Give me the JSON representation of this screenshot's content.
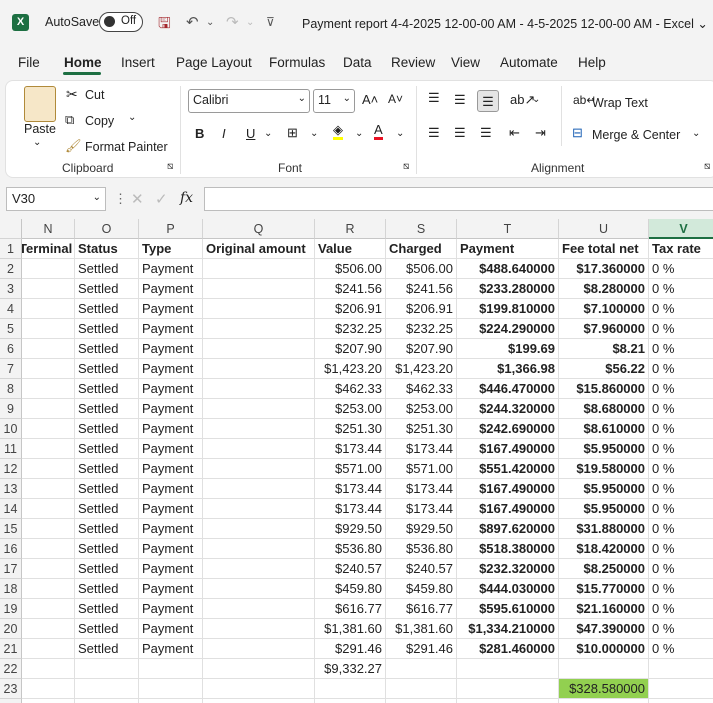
{
  "titlebar": {
    "logo": "X",
    "autosave_label": "AutoSave",
    "autosave_state": "Off",
    "title": "Payment report 4-4-2025 12-00-00 AM - 4-5-2025 12-00-00 AM  -  Excel ⌄"
  },
  "menu": [
    "File",
    "Home",
    "Insert",
    "Page Layout",
    "Formulas",
    "Data",
    "Review",
    "View",
    "Automate",
    "Help"
  ],
  "ribbon": {
    "paste": "Paste",
    "cut": "Cut",
    "copy": "Copy",
    "format_painter": "Format Painter",
    "clipboard_label": "Clipboard",
    "font_name": "Calibri",
    "font_size": "11",
    "font_label": "Font",
    "wrap_text": "Wrap Text",
    "merge_center": "Merge & Center",
    "alignment_label": "Alignment"
  },
  "formula_bar": {
    "name_box": "V30",
    "formula": ""
  },
  "sheet": {
    "columns": [
      {
        "letter": "N",
        "header": "Terminal"
      },
      {
        "letter": "O",
        "header": "Status"
      },
      {
        "letter": "P",
        "header": "Type"
      },
      {
        "letter": "Q",
        "header": "Original amount"
      },
      {
        "letter": "R",
        "header": "Value"
      },
      {
        "letter": "S",
        "header": "Charged"
      },
      {
        "letter": "T",
        "header": "Payment"
      },
      {
        "letter": "U",
        "header": "Fee total net"
      },
      {
        "letter": "V",
        "header": "Tax rate"
      }
    ],
    "rows": [
      [
        "",
        "Settled",
        "Payment",
        "",
        "$506.00",
        "$506.00",
        "$488.640000",
        "$17.360000",
        "0 %"
      ],
      [
        "",
        "Settled",
        "Payment",
        "",
        "$241.56",
        "$241.56",
        "$233.280000",
        "$8.280000",
        "0 %"
      ],
      [
        "",
        "Settled",
        "Payment",
        "",
        "$206.91",
        "$206.91",
        "$199.810000",
        "$7.100000",
        "0 %"
      ],
      [
        "",
        "Settled",
        "Payment",
        "",
        "$232.25",
        "$232.25",
        "$224.290000",
        "$7.960000",
        "0 %"
      ],
      [
        "",
        "Settled",
        "Payment",
        "",
        "$207.90",
        "$207.90",
        "$199.69",
        "$8.21",
        "0 %"
      ],
      [
        "",
        "Settled",
        "Payment",
        "",
        "$1,423.20",
        "$1,423.20",
        "$1,366.98",
        "$56.22",
        "0 %"
      ],
      [
        "",
        "Settled",
        "Payment",
        "",
        "$462.33",
        "$462.33",
        "$446.470000",
        "$15.860000",
        "0 %"
      ],
      [
        "",
        "Settled",
        "Payment",
        "",
        "$253.00",
        "$253.00",
        "$244.320000",
        "$8.680000",
        "0 %"
      ],
      [
        "",
        "Settled",
        "Payment",
        "",
        "$251.30",
        "$251.30",
        "$242.690000",
        "$8.610000",
        "0 %"
      ],
      [
        "",
        "Settled",
        "Payment",
        "",
        "$173.44",
        "$173.44",
        "$167.490000",
        "$5.950000",
        "0 %"
      ],
      [
        "",
        "Settled",
        "Payment",
        "",
        "$571.00",
        "$571.00",
        "$551.420000",
        "$19.580000",
        "0 %"
      ],
      [
        "",
        "Settled",
        "Payment",
        "",
        "$173.44",
        "$173.44",
        "$167.490000",
        "$5.950000",
        "0 %"
      ],
      [
        "",
        "Settled",
        "Payment",
        "",
        "$173.44",
        "$173.44",
        "$167.490000",
        "$5.950000",
        "0 %"
      ],
      [
        "",
        "Settled",
        "Payment",
        "",
        "$929.50",
        "$929.50",
        "$897.620000",
        "$31.880000",
        "0 %"
      ],
      [
        "",
        "Settled",
        "Payment",
        "",
        "$536.80",
        "$536.80",
        "$518.380000",
        "$18.420000",
        "0 %"
      ],
      [
        "",
        "Settled",
        "Payment",
        "",
        "$240.57",
        "$240.57",
        "$232.320000",
        "$8.250000",
        "0 %"
      ],
      [
        "",
        "Settled",
        "Payment",
        "",
        "$459.80",
        "$459.80",
        "$444.030000",
        "$15.770000",
        "0 %"
      ],
      [
        "",
        "Settled",
        "Payment",
        "",
        "$616.77",
        "$616.77",
        "$595.610000",
        "$21.160000",
        "0 %"
      ],
      [
        "",
        "Settled",
        "Payment",
        "",
        "$1,381.60",
        "$1,381.60",
        "$1,334.210000",
        "$47.390000",
        "0 %"
      ],
      [
        "",
        "Settled",
        "Payment",
        "",
        "$291.46",
        "$291.46",
        "$281.460000",
        "$10.000000",
        "0 %"
      ],
      [
        "",
        "",
        "",
        "",
        "$9,332.27",
        "",
        "",
        "",
        ""
      ],
      [
        "",
        "",
        "",
        "",
        "",
        "",
        "",
        "$328.580000",
        ""
      ],
      [
        "",
        "",
        "",
        "",
        "",
        "",
        "",
        "",
        ""
      ]
    ],
    "highlight_color": "#92d050"
  }
}
